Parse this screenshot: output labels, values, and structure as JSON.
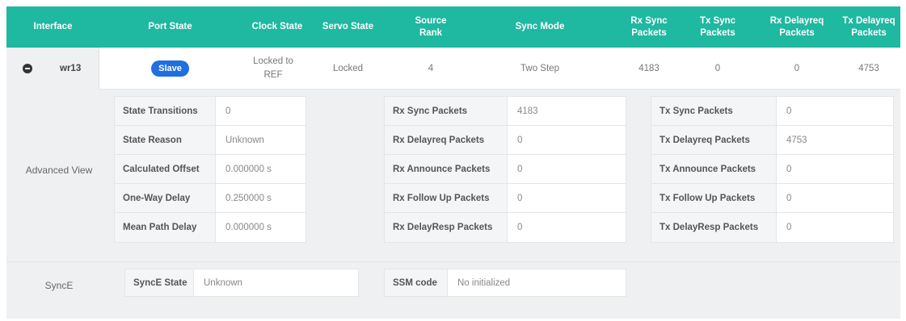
{
  "header": {
    "interface": "Interface",
    "port_state": "Port State",
    "clock_state": "Clock State",
    "servo_state": "Servo State",
    "source_rank": "Source Rank",
    "sync_mode": "Sync Mode",
    "rx_sync_packets": "Rx Sync Packets",
    "tx_sync_packets": "Tx Sync Packets",
    "rx_delayreq_packets": "Rx Delayreq Packets",
    "tx_delayreq_packets": "Tx Delayreq Packets"
  },
  "row": {
    "interface": "wr13",
    "port_state": "Slave",
    "clock_state": "Locked to REF",
    "servo_state": "Locked",
    "source_rank": "4",
    "sync_mode": "Two Step",
    "rx_sync_packets": "4183",
    "tx_sync_packets": "0",
    "rx_delayreq_packets": "0",
    "tx_delayreq_packets": "4753"
  },
  "advanced": {
    "label": "Advanced View",
    "state": [
      {
        "key": "State Transitions",
        "value": "0"
      },
      {
        "key": "State Reason",
        "value": "Unknown"
      },
      {
        "key": "Calculated Offset",
        "value": "0.000000 s"
      },
      {
        "key": "One-Way Delay",
        "value": "0.250000 s"
      },
      {
        "key": "Mean Path Delay",
        "value": "0.000000 s"
      }
    ],
    "rx": [
      {
        "key": "Rx Sync Packets",
        "value": "4183"
      },
      {
        "key": "Rx Delayreq Packets",
        "value": "0"
      },
      {
        "key": "Rx Announce Packets",
        "value": "0"
      },
      {
        "key": "Rx Follow Up Packets",
        "value": "0"
      },
      {
        "key": "Rx DelayResp Packets",
        "value": "0"
      }
    ],
    "tx": [
      {
        "key": "Tx Sync Packets",
        "value": "0"
      },
      {
        "key": "Tx Delayreq Packets",
        "value": "4753"
      },
      {
        "key": "Tx Announce Packets",
        "value": "0"
      },
      {
        "key": "Tx Follow Up Packets",
        "value": "0"
      },
      {
        "key": "Tx DelayResp Packets",
        "value": "0"
      }
    ]
  },
  "synce": {
    "label": "SyncE",
    "state_key": "SyncE State",
    "state_value": "Unknown",
    "ssm_key": "SSM code",
    "ssm_value": "No initialized"
  },
  "colors": {
    "header_bg": "#1fb8a1",
    "slave_badge": "#1f6fe0"
  },
  "icons": {
    "collapse": "minus-circle-icon"
  }
}
